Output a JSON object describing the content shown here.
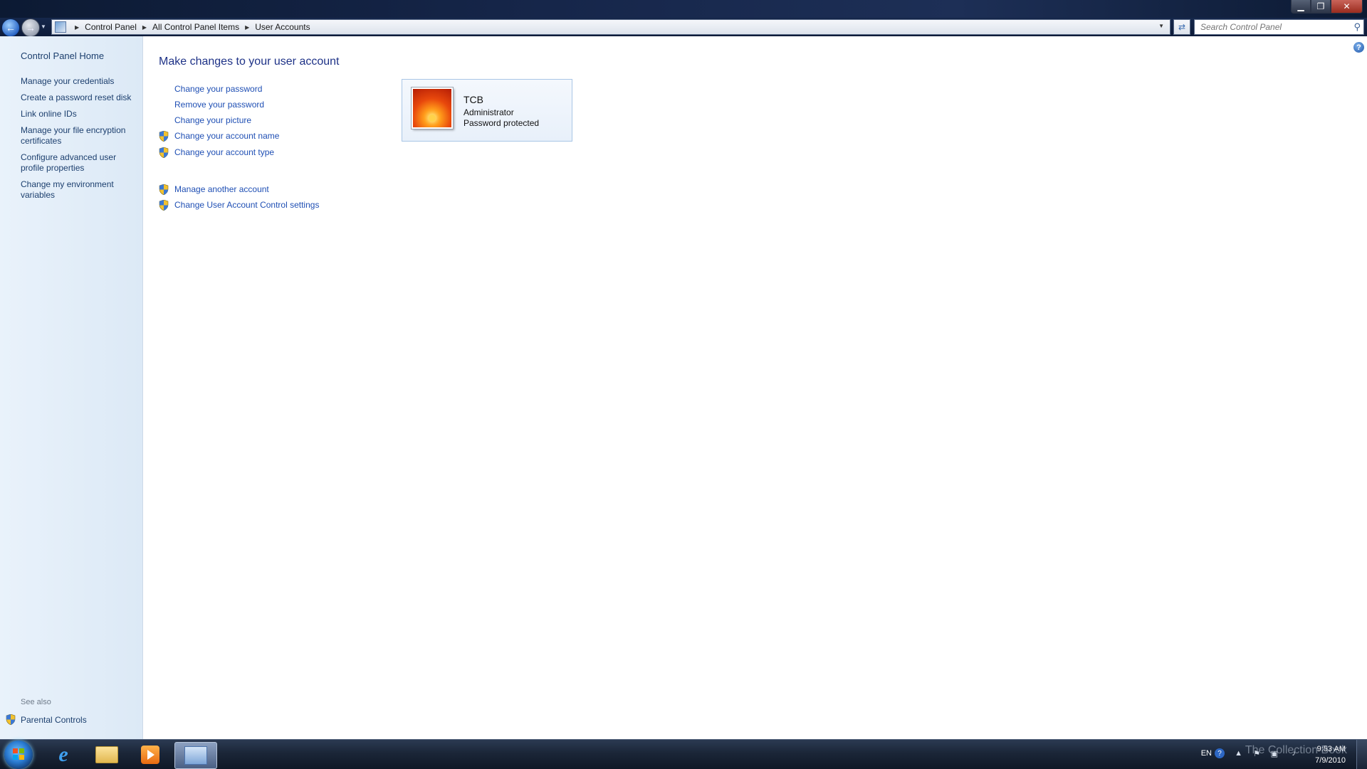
{
  "window": {
    "minimize": "▁",
    "maximize": "❐",
    "close": "✕"
  },
  "address": {
    "crumbs": [
      "Control Panel",
      "All Control Panel Items",
      "User Accounts"
    ],
    "search_placeholder": "Search Control Panel"
  },
  "sidebar": {
    "home": "Control Panel Home",
    "tasks": [
      "Manage your credentials",
      "Create a password reset disk",
      "Link online IDs",
      "Manage your file encryption certificates",
      "Configure advanced user profile properties",
      "Change my environment variables"
    ],
    "see_also_label": "See also",
    "see_also_items": [
      "Parental Controls"
    ]
  },
  "main": {
    "title": "Make changes to your user account",
    "links": [
      "Change your password",
      "Remove your password",
      "Change your picture",
      "Change your account name",
      "Change your account type"
    ],
    "admin_links": [
      "Manage another account",
      "Change User Account Control settings"
    ],
    "account": {
      "name": "TCB",
      "role": "Administrator",
      "status": "Password protected"
    }
  },
  "taskbar": {
    "language": "EN",
    "time": "9:53 AM",
    "date": "7/9/2010",
    "apps": [
      "internet-explorer-icon",
      "windows-explorer-icon",
      "media-player-icon",
      "control-panel-icon"
    ]
  },
  "watermark": "The Collection Book",
  "colors": {
    "link": "#1f4fb4",
    "title": "#1e3287",
    "sidebar_text": "#1c3f6e",
    "sidebar_bg": "#e9f2fb"
  }
}
